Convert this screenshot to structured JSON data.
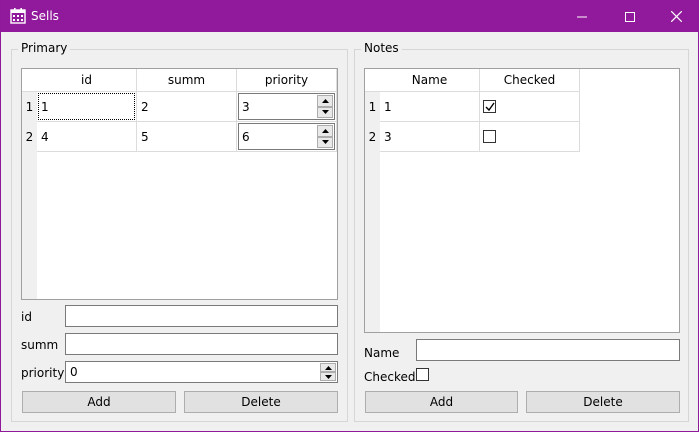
{
  "window": {
    "title": "Sells",
    "icon": "calendar-icon",
    "accent": "#901a9b"
  },
  "primary": {
    "group_title": "Primary",
    "columns": [
      "id",
      "summ",
      "priority"
    ],
    "rows": [
      {
        "num": "1",
        "id": "1",
        "summ": "2",
        "priority": "3"
      },
      {
        "num": "2",
        "id": "4",
        "summ": "5",
        "priority": "6"
      }
    ],
    "form": {
      "id_label": "id",
      "id_value": "",
      "summ_label": "summ",
      "summ_value": "",
      "priority_label": "priority",
      "priority_value": "0"
    },
    "add_label": "Add",
    "delete_label": "Delete"
  },
  "notes": {
    "group_title": "Notes",
    "columns": [
      "Name",
      "Checked"
    ],
    "rows": [
      {
        "num": "1",
        "name": "1",
        "checked": true
      },
      {
        "num": "2",
        "name": "3",
        "checked": false
      }
    ],
    "form": {
      "name_label": "Name",
      "name_value": "",
      "checked_label": "Checked",
      "checked_value": false
    },
    "add_label": "Add",
    "delete_label": "Delete"
  }
}
